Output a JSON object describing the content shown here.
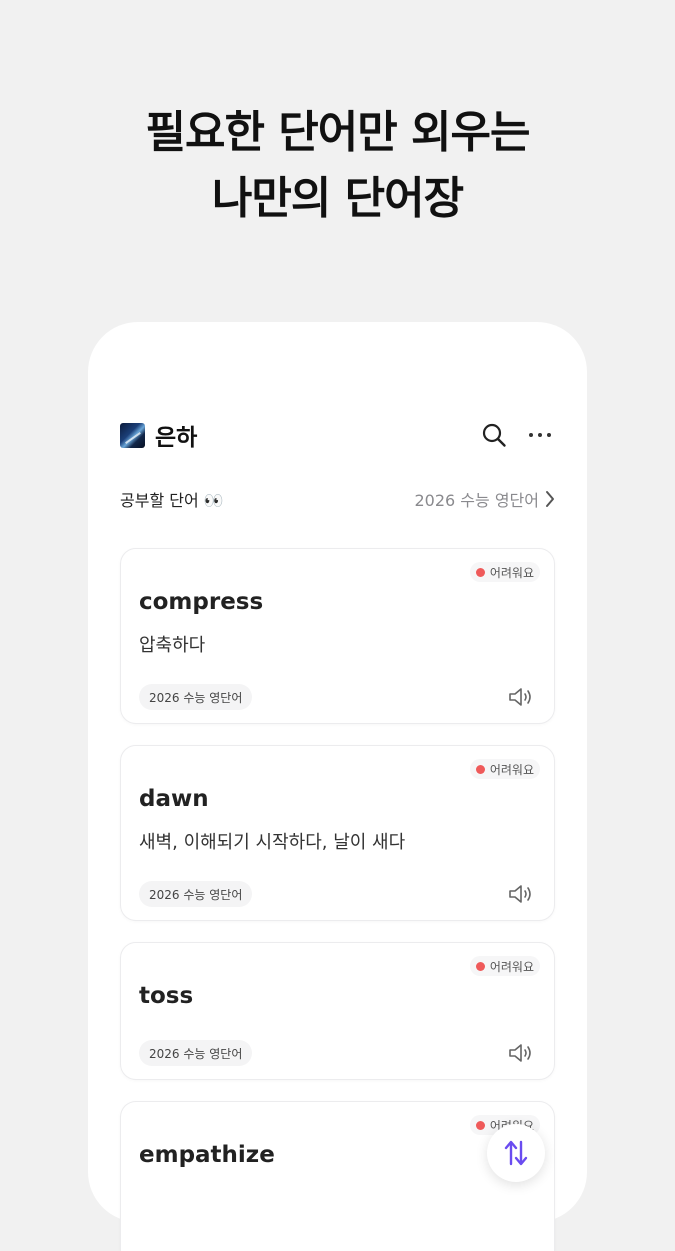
{
  "hero": {
    "line1": "필요한 단어만 외우는",
    "line2": "나만의 단어장"
  },
  "header": {
    "book_title": "은하",
    "search_icon": "search-icon",
    "more_icon": "more-horizontal-icon"
  },
  "subheader": {
    "left_label": "공부할 단어 👀",
    "right_label": "2026 수능 영단어"
  },
  "cards": [
    {
      "badge": "어려워요",
      "word": "compress",
      "meaning": "압축하다",
      "tag": "2026 수능 영단어"
    },
    {
      "badge": "어려워요",
      "word": "dawn",
      "meaning": "새벽, 이해되기 시작하다, 날이 새다",
      "tag": "2026 수능 영단어"
    },
    {
      "badge": "어려워요",
      "word": "toss",
      "meaning": "",
      "tag": "2026 수능 영단어"
    },
    {
      "badge": "어려워요",
      "word": "empathize",
      "meaning": "",
      "tag": ""
    }
  ],
  "colors": {
    "background": "#f1f1f1",
    "badge_dot": "#ef5a5a",
    "fab_icon": "#6a4cf0"
  }
}
